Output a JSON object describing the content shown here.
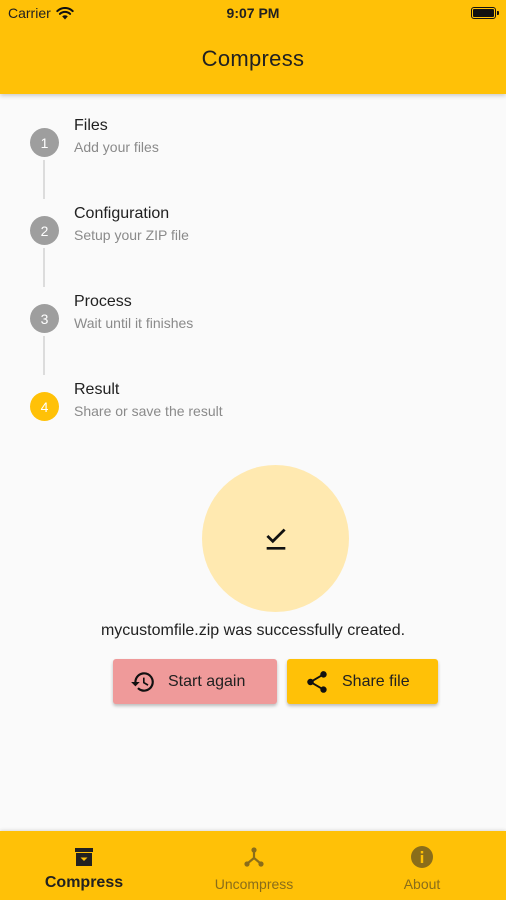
{
  "status_bar": {
    "carrier": "Carrier",
    "time": "9:07 PM"
  },
  "app_bar": {
    "title": "Compress"
  },
  "steps": [
    {
      "number": "1",
      "title": "Files",
      "subtitle": "Add your files",
      "state": "done"
    },
    {
      "number": "2",
      "title": "Configuration",
      "subtitle": "Setup your ZIP file",
      "state": "done"
    },
    {
      "number": "3",
      "title": "Process",
      "subtitle": "Wait until it finishes",
      "state": "done"
    },
    {
      "number": "4",
      "title": "Result",
      "subtitle": "Share or save the result",
      "state": "active"
    }
  ],
  "result": {
    "icon": "download-done-icon",
    "message": "mycustomfile.zip was successfully created."
  },
  "actions": {
    "start_again_label": "Start again",
    "start_again_icon": "history-icon",
    "share_label": "Share file",
    "share_icon": "share-icon"
  },
  "bottom_nav": [
    {
      "label": "Compress",
      "icon": "archive-icon",
      "active": true
    },
    {
      "label": "Uncompress",
      "icon": "unarchive-icon",
      "active": false
    },
    {
      "label": "About",
      "icon": "info-icon",
      "active": false
    }
  ],
  "colors": {
    "primary": "#ffc107",
    "success_circle": "#ffe9b0",
    "start_again_button": "#ef9a9a",
    "step_inactive": "#9e9e9e"
  }
}
